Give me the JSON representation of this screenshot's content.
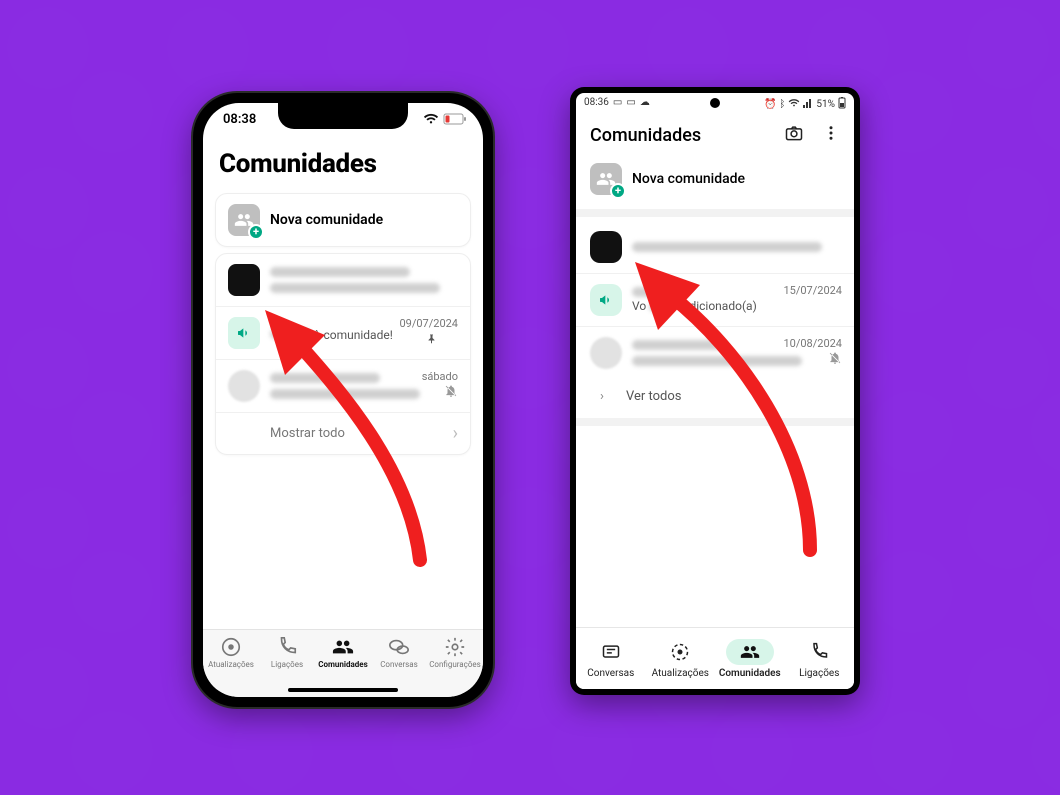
{
  "colors": {
    "accent_green": "#00a884",
    "arrow_red": "#ef1f1f",
    "bg_purple": "#8a2be2"
  },
  "iphone": {
    "status": {
      "time": "08:38"
    },
    "title": "Comunidades",
    "new_community": "Nova comunidade",
    "community": {
      "announcement": {
        "text_visible": "à comunidade!",
        "date": "09/07/2024"
      },
      "group": {
        "date_label": "sábado"
      },
      "show_all": "Mostrar todo"
    },
    "tabs": {
      "updates": "Atualizações",
      "calls": "Ligações",
      "communities": "Comunidades",
      "chats": "Conversas",
      "settings": "Configurações"
    }
  },
  "android": {
    "status": {
      "time": "08:36",
      "battery": "51%"
    },
    "title": "Comunidades",
    "new_community": "Nova comunidade",
    "community": {
      "announcement": {
        "text_visible": "oi adicionado(a)",
        "prefix": "Vo",
        "date": "15/07/2024"
      },
      "group": {
        "date": "10/08/2024"
      },
      "view_all": "Ver todos"
    },
    "tabs": {
      "chats": "Conversas",
      "updates": "Atualizações",
      "communities": "Comunidades",
      "calls": "Ligações"
    }
  }
}
